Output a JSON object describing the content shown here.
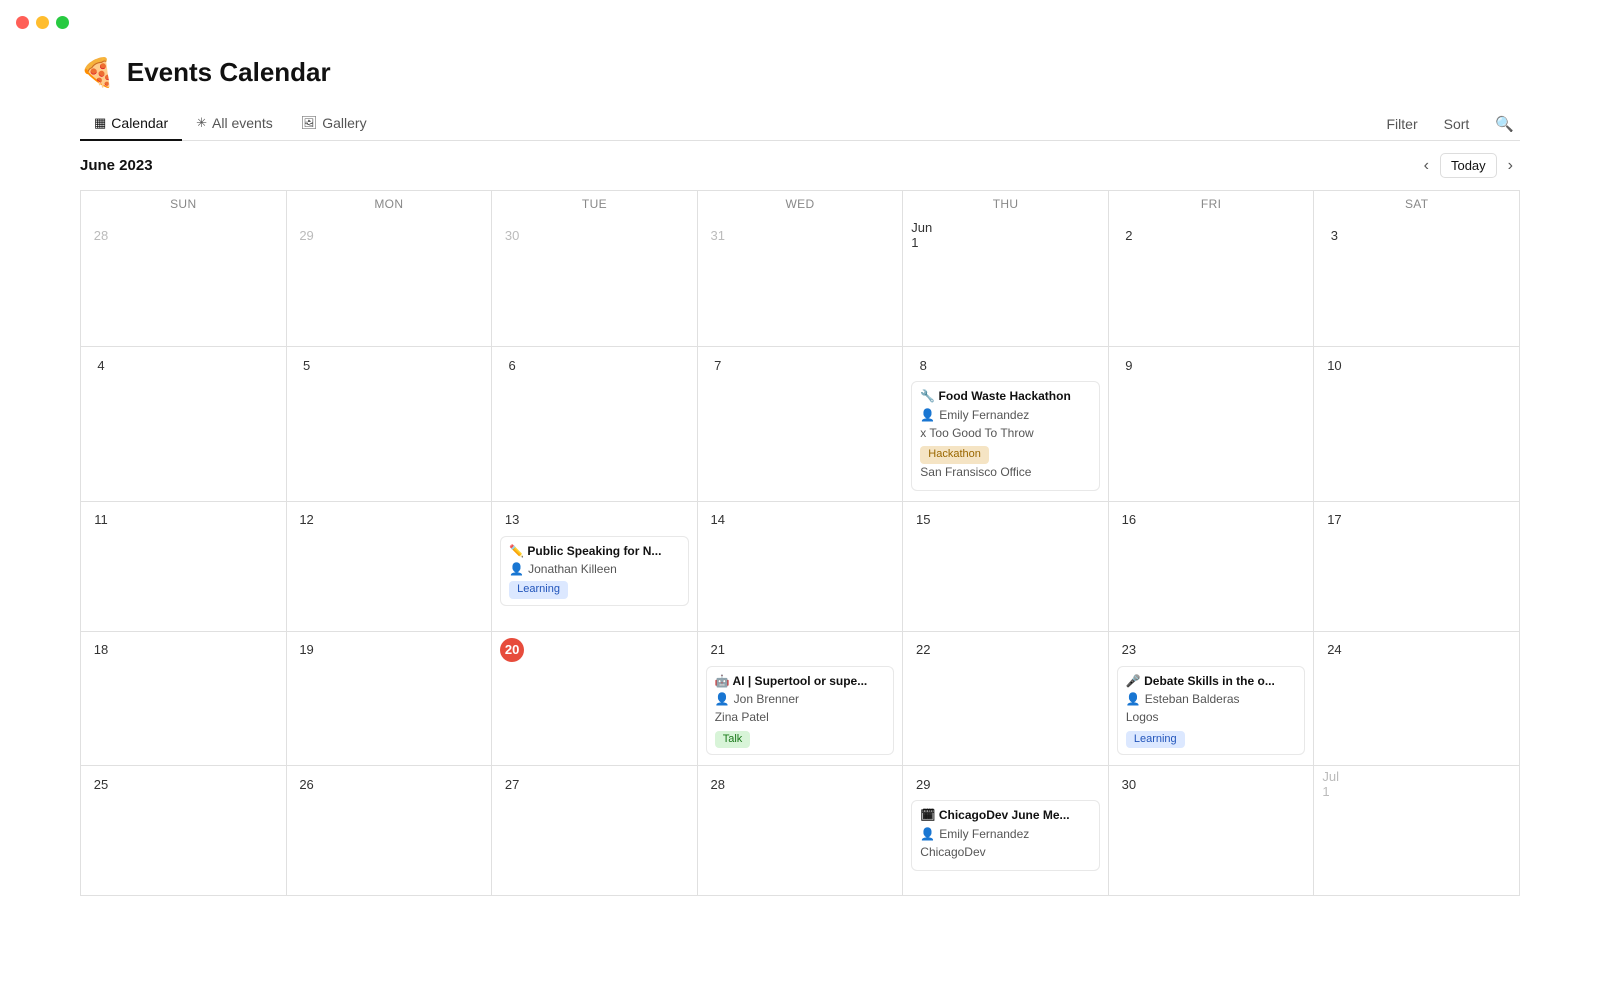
{
  "titlebar": {
    "traffic_lights": [
      "red",
      "yellow",
      "green"
    ]
  },
  "app": {
    "icon": "🍕",
    "title": "Events Calendar"
  },
  "tabs": [
    {
      "id": "calendar",
      "label": "Calendar",
      "icon": "▦",
      "active": true
    },
    {
      "id": "all-events",
      "label": "All events",
      "icon": "✳",
      "active": false
    },
    {
      "id": "gallery",
      "label": "Gallery",
      "icon": "🖼",
      "active": false
    }
  ],
  "toolbar": {
    "filter_label": "Filter",
    "sort_label": "Sort",
    "search_icon": "🔍"
  },
  "calendar": {
    "month_label": "June 2023",
    "today_label": "Today",
    "prev_icon": "‹",
    "next_icon": "›",
    "day_headers": [
      "Sun",
      "Mon",
      "Tue",
      "Wed",
      "Thu",
      "Fri",
      "Sat"
    ]
  },
  "weeks": [
    [
      {
        "day": 28,
        "other": true
      },
      {
        "day": 29,
        "other": true
      },
      {
        "day": 30,
        "other": true
      },
      {
        "day": 31,
        "other": true
      },
      {
        "day": "Jun 1",
        "num": 1
      },
      {
        "day": 2
      },
      {
        "day": 3
      }
    ],
    [
      {
        "day": 4
      },
      {
        "day": 5
      },
      {
        "day": 6
      },
      {
        "day": 7
      },
      {
        "day": 8,
        "event": {
          "emoji": "🔧",
          "title": "Food Waste Hackathon",
          "person": "Emily Fernandez",
          "org": "x Too Good To Throw",
          "tag": "Hackathon",
          "tag_class": "tag-hackathon",
          "location": "San Fransisco Office"
        }
      },
      {
        "day": 9
      },
      {
        "day": 10
      }
    ],
    [
      {
        "day": 11
      },
      {
        "day": 12
      },
      {
        "day": 13,
        "event": {
          "emoji": "✏️",
          "title": "Public Speaking for N...",
          "person": "Jonathan Killeen",
          "tag": "Learning",
          "tag_class": "tag-learning"
        }
      },
      {
        "day": 14
      },
      {
        "day": 15
      },
      {
        "day": 16
      },
      {
        "day": 17
      }
    ],
    [
      {
        "day": 18
      },
      {
        "day": 19
      },
      {
        "day": 20,
        "today": true
      },
      {
        "day": 21,
        "event": {
          "emoji": "🤖",
          "title": "AI | Supertool or supe...",
          "person": "Jon Brenner",
          "org": "Zina Patel",
          "tag": "Talk",
          "tag_class": "tag-talk"
        }
      },
      {
        "day": 22
      },
      {
        "day": 23,
        "event": {
          "emoji": "🎤",
          "title": "Debate Skills in the o...",
          "person": "Esteban Balderas",
          "org": "Logos",
          "tag": "Learning",
          "tag_class": "tag-learning"
        }
      },
      {
        "day": 24
      }
    ],
    [
      {
        "day": 25
      },
      {
        "day": 26
      },
      {
        "day": 27
      },
      {
        "day": 28
      },
      {
        "day": 29,
        "event": {
          "emoji": "🗓",
          "title": "ChicagoDev June Me...",
          "person": "Emily Fernandez",
          "org": "ChicagoDev"
        }
      },
      {
        "day": 30
      },
      {
        "day": "Jul 1",
        "other": true
      }
    ]
  ]
}
